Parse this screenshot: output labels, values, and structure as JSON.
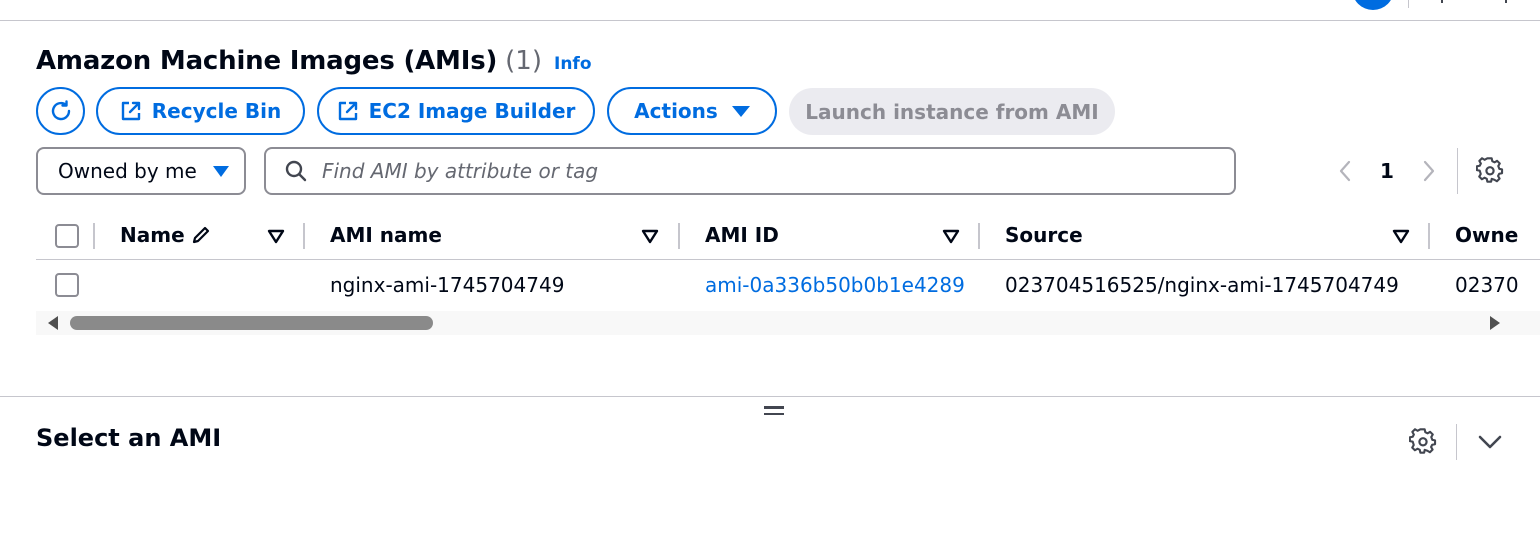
{
  "header": {
    "title": "Amazon Machine Images (AMIs)",
    "count": "(1)",
    "info_label": "Info"
  },
  "toolbar": {
    "refresh_icon": "refresh-icon",
    "recycle_bin_label": "Recycle Bin",
    "image_builder_label": "EC2 Image Builder",
    "actions_label": "Actions",
    "launch_label": "Launch instance from AMI"
  },
  "filter": {
    "owner_selected": "Owned by me",
    "search_placeholder": "Find AMI by attribute or tag"
  },
  "pagination": {
    "current_page": "1"
  },
  "table": {
    "columns": [
      "Name",
      "AMI name",
      "AMI ID",
      "Source",
      "Owne"
    ],
    "rows": [
      {
        "name": "",
        "ami_name": "nginx-ami-1745704749",
        "ami_id": "ami-0a336b50b0b1e4289",
        "source": "023704516525/nginx-ami-1745704749",
        "owner": "02370"
      }
    ]
  },
  "details": {
    "title": "Select an AMI"
  },
  "colors": {
    "accent": "#006ce0",
    "disabled_bg": "#ebebf0",
    "disabled_text": "#8c8c94",
    "border": "#8c8c94",
    "divider": "#c6c6cd"
  }
}
